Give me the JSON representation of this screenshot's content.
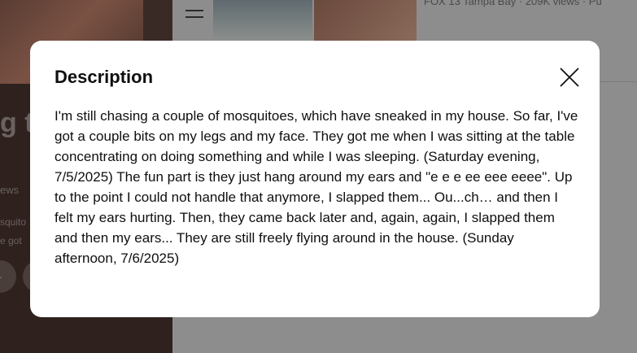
{
  "background": {
    "title_fragment": "g t",
    "meta_fragment": "ews",
    "desc_lines": [
      "squito",
      "e got"
    ],
    "circle_label": "-",
    "top_meta": "FOX 13 Tampa Bay · 209K views · Pu"
  },
  "modal": {
    "title": "Description",
    "close_icon": "close-icon",
    "body": "I'm still chasing a couple of mosquitoes, which have sneaked in my house. So far, I've got a couple bits on my legs and my face. They got me when I was sitting at the table concentrating on doing something and while I was sleeping. (Saturday evening, 7/5/2025) The fun part is they just hang around my ears and \"e e e ee eee eeee\". Up to the point I could not handle that anymore, I slapped them... Ou...ch… and then I felt my ears hurting. Then, they came back later and, again, again, I slapped them and then my ears... They are still freely flying around in the house. (Sunday afternoon, 7/6/2025)"
  },
  "colors": {
    "modal_bg": "#ffffff",
    "text": "#0f0f0f",
    "overlay": "#8d8d8d"
  }
}
